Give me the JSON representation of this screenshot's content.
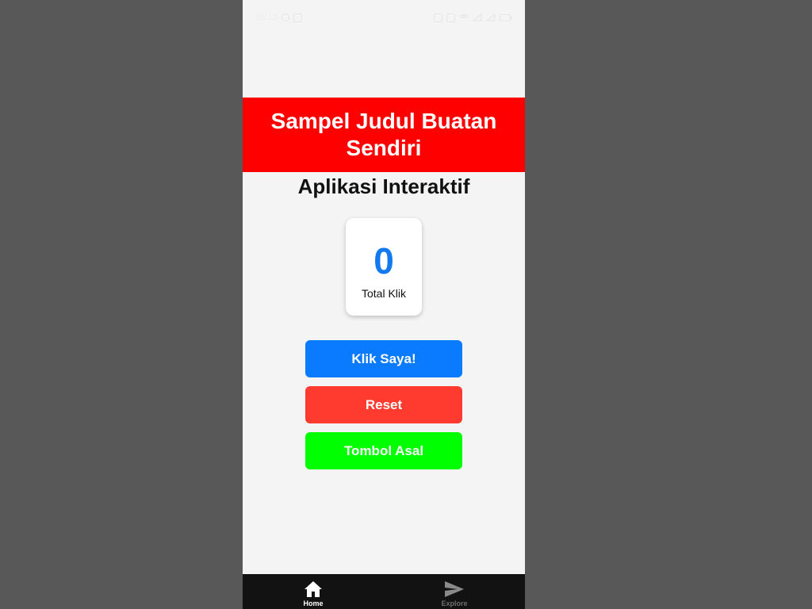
{
  "status_bar": {
    "time": "10:12",
    "left_icons": [
      "whatsapp-icon",
      "notification-icon"
    ],
    "right_icons": [
      "sim-icon",
      "vibrate-icon",
      "wifi-icon",
      "signal-icon",
      "signal-icon",
      "battery-icon"
    ]
  },
  "header": {
    "title": "Sampel Judul Buatan Sendiri",
    "color": "#ff0000"
  },
  "subtitle": "Aplikasi Interaktif",
  "counter": {
    "value": "0",
    "label": "Total Klik"
  },
  "buttons": {
    "click": "Klik Saya!",
    "reset": "Reset",
    "original": "Tombol Asal"
  },
  "colors": {
    "click": "#0a7aff",
    "reset": "#ff3b30",
    "original": "#00ff00",
    "counter": "#1279ee"
  },
  "bottom_nav": {
    "tabs": [
      {
        "label": "Home",
        "icon": "home-icon",
        "active": true
      },
      {
        "label": "Explore",
        "icon": "send-icon",
        "active": false
      }
    ]
  }
}
